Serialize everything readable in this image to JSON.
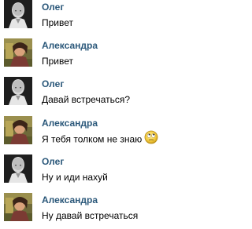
{
  "messages": [
    {
      "author": "Олег",
      "text": "Привет",
      "avatar": "oleg-avatar"
    },
    {
      "author": "Александра",
      "text": "Привет",
      "avatar": "aleksandra-avatar"
    },
    {
      "author": "Олег",
      "text": "Давай встречаться?",
      "avatar": "oleg-avatar"
    },
    {
      "author": "Александра",
      "text": "Я тебя толком не знаю",
      "avatar": "aleksandra-avatar",
      "emoji": "rolling-eyes-emoji"
    },
    {
      "author": "Олег",
      "text": "Ну и иди нахуй",
      "avatar": "oleg-avatar"
    },
    {
      "author": "Александра",
      "text": "Ну давай встречаться",
      "avatar": "aleksandra-avatar"
    }
  ],
  "colors": {
    "author_name": "#2b587a",
    "message_text": "#000000",
    "background": "#ffffff"
  }
}
